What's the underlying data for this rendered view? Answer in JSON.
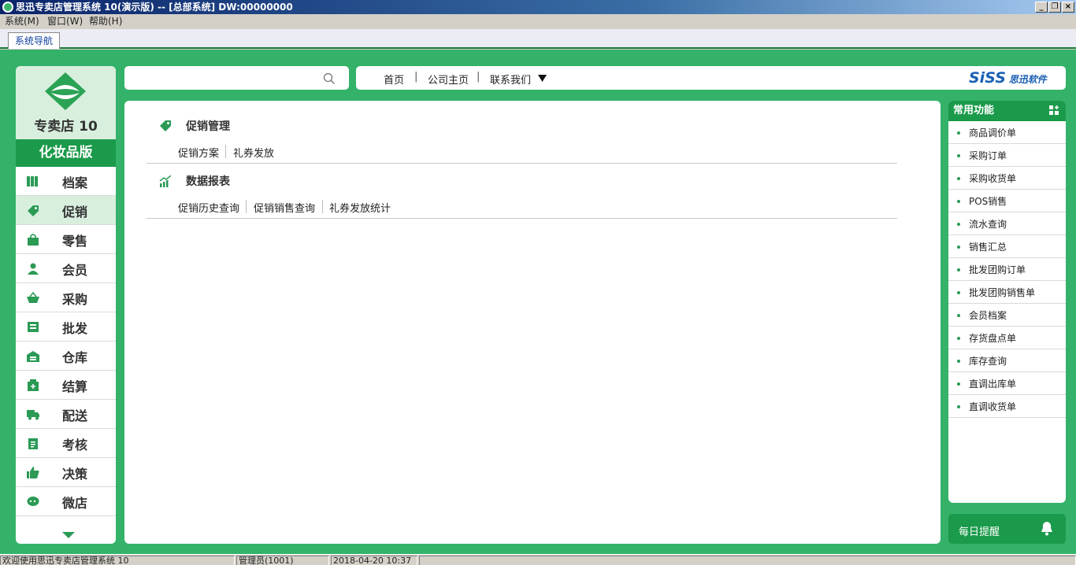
{
  "window": {
    "title": "思迅专卖店管理系统 10(演示版) -- [总部系统] DW:00000000",
    "min_glyph": "_",
    "restore_glyph": "❐",
    "close_glyph": "×"
  },
  "menubar": {
    "items": [
      "系统(M)",
      "窗口(W)",
      "帮助(H)"
    ]
  },
  "tabs": [
    "系统导航"
  ],
  "sidebar": {
    "product_name": "专卖店 10",
    "edition": "化妆品版",
    "items": [
      {
        "label": "档案",
        "icon": "archive-icon"
      },
      {
        "label": "促销",
        "icon": "tag-icon",
        "active": true
      },
      {
        "label": "零售",
        "icon": "shopping-bag-icon"
      },
      {
        "label": "会员",
        "icon": "user-icon"
      },
      {
        "label": "采购",
        "icon": "basket-icon"
      },
      {
        "label": "批发",
        "icon": "wholesale-icon"
      },
      {
        "label": "仓库",
        "icon": "warehouse-icon"
      },
      {
        "label": "结算",
        "icon": "settlement-icon"
      },
      {
        "label": "配送",
        "icon": "truck-icon"
      },
      {
        "label": "考核",
        "icon": "clipboard-icon"
      },
      {
        "label": "决策",
        "icon": "thumbs-up-icon"
      },
      {
        "label": "微店",
        "icon": "chat-icon"
      }
    ],
    "more_icon": "chevron-down-icon"
  },
  "search": {
    "placeholder": "",
    "value": "",
    "icon": "search-icon"
  },
  "topnav": {
    "links": [
      "首页",
      "公司主页",
      "联系我们"
    ],
    "separator": "|",
    "dropdown_icon": "triangle-down-icon",
    "brand_logo": "SiSS",
    "brand_name": "思迅软件"
  },
  "main": {
    "sections": [
      {
        "title": "促销管理",
        "icon": "tag-icon",
        "links": [
          "促销方案",
          "礼券发放"
        ]
      },
      {
        "title": "数据报表",
        "icon": "chart-icon",
        "links": [
          "促销历史查询",
          "促销销售查询",
          "礼券发放统计"
        ]
      }
    ]
  },
  "quick_functions": {
    "title": "常用功能",
    "add_icon": "grid-plus-icon",
    "items": [
      "商品调价单",
      "采购订单",
      "采购收货单",
      "POS销售",
      "流水查询",
      "销售汇总",
      "批发团购订单",
      "批发团购销售单",
      "会员档案",
      "存货盘点单",
      "库存查询",
      "直调出库单",
      "直调收货单"
    ]
  },
  "reminder": {
    "label": "每日提醒",
    "icon": "bell-icon"
  },
  "statusbar": {
    "welcome": "欢迎使用思迅专卖店管理系统 10",
    "user": "管理员(1001)",
    "datetime": "2018-04-20 10:37"
  },
  "colors": {
    "green": "#34b26a",
    "dark_green": "#1a9a4a",
    "brand_blue": "#1a5fb4",
    "titlebar": "#0a246a"
  }
}
